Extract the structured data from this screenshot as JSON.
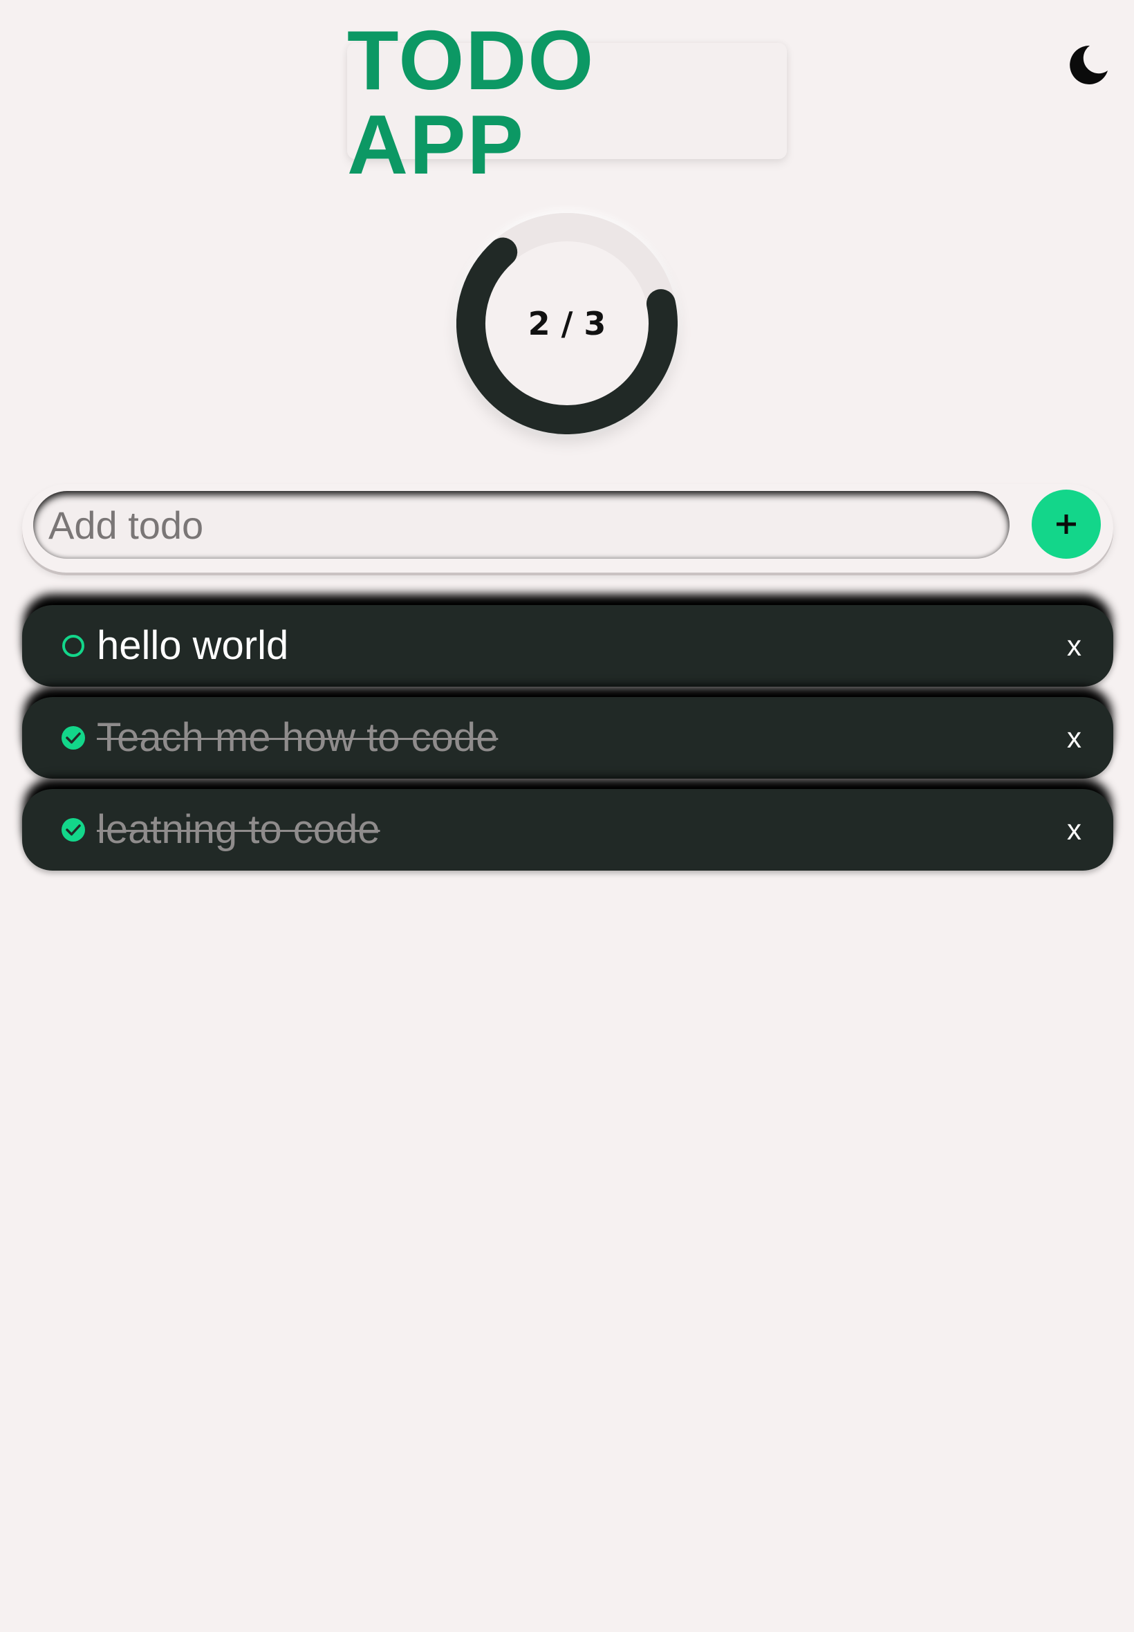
{
  "header": {
    "title": "TODO APP",
    "title_color": "#0c9864",
    "theme_toggle_icon": "moon-icon"
  },
  "progress": {
    "completed": 2,
    "total": 3,
    "label": "2 / 3"
  },
  "add_form": {
    "placeholder": "Add todo",
    "value": "",
    "add_button_icon": "plus-icon",
    "accent_color": "#13d68a"
  },
  "todos": [
    {
      "text": "hello world",
      "done": false
    },
    {
      "text": "Teach me how to code",
      "done": true
    },
    {
      "text": "leatning to code",
      "done": true
    }
  ],
  "todo_delete_label": "x",
  "colors": {
    "background": "#f6f1f1",
    "todo_background": "#212926",
    "ring": "#212926"
  }
}
